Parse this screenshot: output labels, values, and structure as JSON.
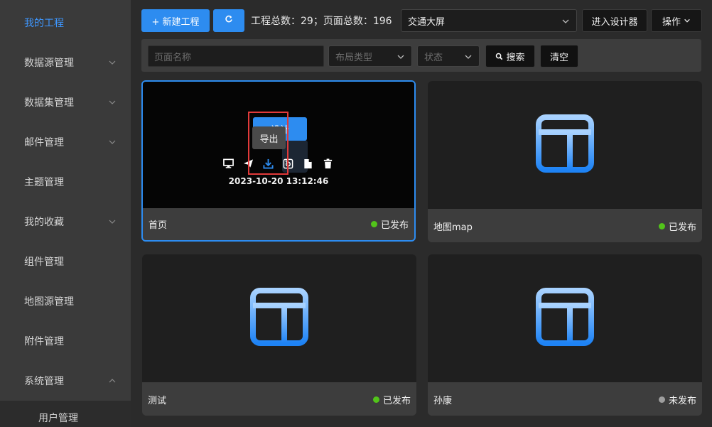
{
  "sidebar": {
    "items": [
      {
        "label": "我的工程",
        "active": true,
        "has_arrow": false
      },
      {
        "label": "数据源管理",
        "has_arrow": true
      },
      {
        "label": "数据集管理",
        "has_arrow": true
      },
      {
        "label": "邮件管理",
        "has_arrow": true
      },
      {
        "label": "主题管理",
        "has_arrow": false
      },
      {
        "label": "我的收藏",
        "has_arrow": true
      },
      {
        "label": "组件管理",
        "has_arrow": false
      },
      {
        "label": "地图源管理",
        "has_arrow": false
      },
      {
        "label": "附件管理",
        "has_arrow": false
      },
      {
        "label": "系统管理",
        "has_arrow": true,
        "expanded": true
      }
    ],
    "sub_item": "用户管理"
  },
  "toolbar": {
    "new_project": "+ 新建工程",
    "refresh_icon": "refresh-icon",
    "stats": "工程总数：29；页面总数：196",
    "project_select": "交通大屏",
    "enter_designer": "进入设计器",
    "operations": "操作"
  },
  "filters": {
    "page_name_placeholder": "页面名称",
    "layout_type_placeholder": "布局类型",
    "status_placeholder": "状态",
    "search": "搜索",
    "clear": "清空"
  },
  "cards": [
    {
      "name": "首页",
      "status": "已发布",
      "status_color": "#52c41a"
    },
    {
      "name": "地图map",
      "status": "已发布",
      "status_color": "#52c41a"
    },
    {
      "name": "测试",
      "status": "已发布",
      "status_color": "#52c41a"
    },
    {
      "name": "孙康",
      "status": "未发布",
      "status_color": "#9e9e9e"
    }
  ],
  "hover": {
    "design_button": "设计",
    "timestamp": "2023-10-20 13:12:46",
    "tooltip": "导出",
    "actions": [
      "preview-icon",
      "publish-icon",
      "export-icon",
      "import-icon",
      "copy-icon",
      "delete-icon"
    ]
  },
  "colors": {
    "accent": "#2d8cf0",
    "highlight": "#e23a3a"
  }
}
